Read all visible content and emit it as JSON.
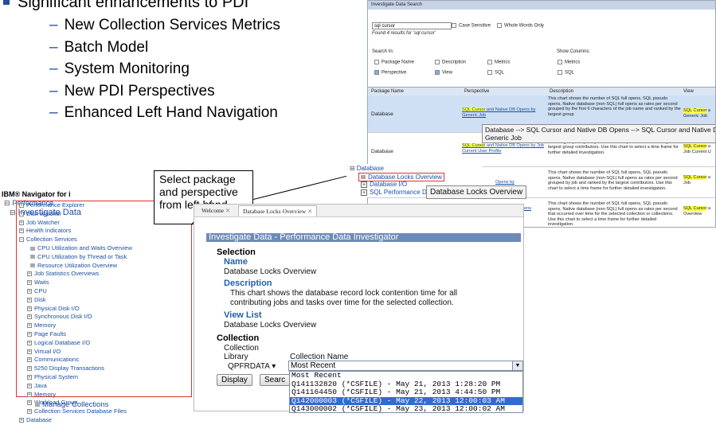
{
  "slide": {
    "bullet": "Significant enhancements to PDI",
    "subitems": [
      "New Collection Services Metrics",
      "Batch Model",
      "System Monitoring",
      "New PDI Perspectives",
      "Enhanced Left Hand Navigation"
    ],
    "callout": "Select package and perspective from left hand"
  },
  "navigator": {
    "brand": "IBM® Navigator for i",
    "performance": "Performance",
    "investigate": "Investigate Data",
    "items": [
      "Performance Explorer",
      "Disk Watcher",
      "Job Watcher",
      "Health Indicators",
      "Collection Services"
    ],
    "collection_items": [
      "CPU Utilization and Waits Overview",
      "CPU Utilization by Thread or Task",
      "Resource Utilization Overview",
      "Job Statistics Overviews",
      "Waits",
      "CPU",
      "Disk",
      "Physical Disk I/O",
      "Synchronous Disk I/O",
      "Memory",
      "Page Faults",
      "Logical Database I/O",
      "Virtual I/O",
      "Communications",
      "5250 Display Transactions",
      "Physical System",
      "Java",
      "Memory",
      "Workload Group",
      "Collection Services Database Files"
    ],
    "database": "Database",
    "manage": "Manage Collections"
  },
  "search": {
    "title": "Investigate Data Search",
    "query": "sql cursor",
    "case_sensitive": "Case Sensitive",
    "whole_words": "Whole Words Only",
    "results_note": "Found 4 results for 'sql cursor'",
    "search_in": "Search In:",
    "show_columns": "Show Columns:",
    "opts": {
      "package": "Package Name",
      "description": "Description",
      "metrics": "Metrics",
      "perspective": "Perspective",
      "view": "View",
      "sql": "SQL",
      "metrics2": "Metrics",
      "sql2": "SQL"
    },
    "cols": {
      "package": "Package Name",
      "perspective": "Perspective",
      "description": "Description",
      "view": "View"
    },
    "rows": [
      {
        "package": "Database",
        "persp_hl": "SQL Cursor",
        "persp": " and Native DB Opens by Generic Job",
        "desc": "This chart shows the number of SQL full opens, SQL pseudo opens, Native database (non-SQL) full opens as rates per second grouped by the first 6 characters of the job name and ranked by the largest group",
        "view_hl": "SQL Cursor",
        "view": " a",
        "view2": "Generic Job"
      },
      {
        "package": "Database",
        "persp_hl": "SQL Cursor",
        "persp": " and Native DB Opens by Job Current User Profile",
        "desc": "pseudo opens, Native database (non-SQL) full opens as rates per second grouped by the job current user profile and ranked by the largest group contributors. Use this chart to select a time frame for further detailed investigation.",
        "view_hl": "SQL Cursor",
        "view": " a",
        "view2": "Job Current U"
      },
      {
        "package": "",
        "persp": " Opens by",
        "desc": "This chart shows the number of SQL full opens, SQL pseudo opens, Native database (non-SQL) full opens as rates per second grouped by job and ranked by the largest contributors. Use this chart to select a time frame for further detailed investigation.",
        "view_hl": "SQL Cursor",
        "view": " a",
        "view2": "Job"
      },
      {
        "package": "",
        "persp": "ens",
        "desc": "This chart shows the number of SQL full opens, SQL pseudo opens, Native database (non-SQL) full opens as rates per second that occurred over time for the selected collection or collections. Use this chart to select a time frame for further detailed investigation.",
        "view_hl": "SQL Cursor",
        "view": " a",
        "view2": "Overview"
      }
    ],
    "tooltip1": "Database --> SQL Cursor and Native DB Opens --> SQL Cursor and Native DB Opens",
    "tooltip2": "Generic Job"
  },
  "tree2": {
    "database": "Database",
    "locks": "Database Locks Overview",
    "io": "Database I/O",
    "sqlperf": "SQL Performance Da",
    "tooltip": "Database Locks Overview"
  },
  "pdi": {
    "tabs": [
      "Welcome",
      "Database Locks Overview"
    ],
    "title": "Investigate Data - Performance Data Investigator",
    "selection": "Selection",
    "name_h": "Name",
    "name": "Database Locks Overview",
    "desc_h": "Description",
    "desc1": "This chart shows the database record lock contention time for all",
    "desc2": "contributing jobs and tasks over time for the selected collection.",
    "view_h": "View List",
    "view": "Database Locks Overview",
    "collection": "Collection",
    "coll_label": "Collection",
    "library_label": "Library",
    "library_value": "QPFRDATA",
    "coll_name_label": "Collection Name",
    "coll_name_value": "Most Recent",
    "options": [
      "Most Recent",
      "Q141132820 (*CSFILE) - May 21, 2013 1:28:20 PM",
      "Q141164450 (*CSFILE) - May 21, 2013 4:44:50 PM",
      "Q142000003 (*CSFILE) - May 22, 2013 12:00:03 AM",
      "Q143000002 (*CSFILE) - May 23, 2013 12:00:02 AM"
    ],
    "display_btn": "Display",
    "search_btn": "Searc"
  }
}
